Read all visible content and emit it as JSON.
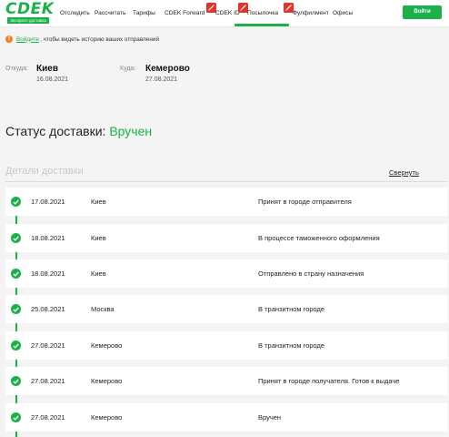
{
  "header": {
    "logo": {
      "text": "CDEK",
      "subtext": "Экспресс-доставка"
    },
    "nav": [
      {
        "label": "Отследить",
        "badge": false
      },
      {
        "label": "Рассчитать",
        "badge": false
      },
      {
        "label": "Тарифы",
        "badge": false
      },
      {
        "label": "CDEK Forward",
        "badge": false
      },
      {
        "label": "CDEK ID",
        "badge": true
      },
      {
        "label": "Посылочка",
        "badge": true
      },
      {
        "label": "Фулфилмент",
        "badge": true
      },
      {
        "label": "Офисы",
        "badge": false
      }
    ],
    "login_label": "Войти"
  },
  "notice": {
    "link": "Войдите",
    "text": ", чтобы видеть историю ваших отправлений"
  },
  "route": {
    "from_label": "Откуда:",
    "from_city": "Киев",
    "from_date": "16.08.2021",
    "to_label": "Куда:",
    "to_city": "Кемерово",
    "to_date": "27.08.2021"
  },
  "status": {
    "label": "Статус доставки:",
    "value": "Вручен"
  },
  "details": {
    "title": "Детали доставки",
    "collapse_label": "Свернуть",
    "events": [
      {
        "date": "17.08.2021",
        "city": "Киев",
        "status": "Принят в городе отправителя"
      },
      {
        "date": "18.08.2021",
        "city": "Киев",
        "status": "В процессе таможенного оформления"
      },
      {
        "date": "18.08.2021",
        "city": "Киев",
        "status": "Отправлено в страну назначения"
      },
      {
        "date": "25.08.2021",
        "city": "Москва",
        "status": "В транзитном городе"
      },
      {
        "date": "27.08.2021",
        "city": "Кемерово",
        "status": "В транзитном городе"
      },
      {
        "date": "27.08.2021",
        "city": "Кемерово",
        "status": "Принят в городе получателя. Готов к выдаче"
      },
      {
        "date": "27.08.2021",
        "city": "Кемерово",
        "status": "Вручен"
      }
    ]
  },
  "colors": {
    "brand_green": "#1ab248",
    "warning_orange": "#ee7f2b",
    "badge_red": "#e5332a"
  }
}
